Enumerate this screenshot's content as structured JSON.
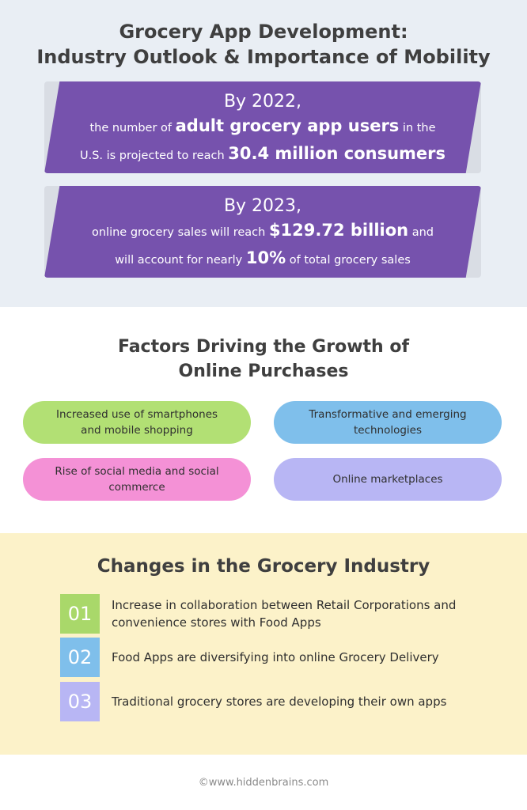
{
  "header": {
    "title_line1": "Grocery App Development:",
    "title_line2": "Industry Outlook & Importance of Mobility"
  },
  "stats": [
    {
      "year": "By 2022,",
      "line1_pre": "the number of ",
      "line1_bold": "adult grocery app users",
      "line1_post": " in the",
      "line2_pre": "U.S. is projected to reach ",
      "line2_bold": "30.4 million consumers",
      "line2_post": ""
    },
    {
      "year": "By 2023,",
      "line1_pre": "online grocery sales will reach ",
      "line1_bold": "$129.72 billion",
      "line1_post": " and",
      "line2_pre": "will account for nearly ",
      "line2_bold": "10%",
      "line2_post": " of total grocery sales"
    }
  ],
  "factors": {
    "title_line1": "Factors Driving the Growth of",
    "title_line2": "Online Purchases",
    "items": [
      {
        "line1": "Increased use of smartphones",
        "line2": "and mobile shopping",
        "color": "#b2e074"
      },
      {
        "line1": "Transformative and emerging",
        "line2": "technologies",
        "color": "#7fbfeb"
      },
      {
        "line1": "Rise of social media and social",
        "line2": "commerce",
        "color": "#f491d6"
      },
      {
        "line1": "Online marketplaces",
        "line2": "",
        "color": "#b8b6f4"
      }
    ]
  },
  "changes": {
    "title": "Changes in the Grocery Industry",
    "items": [
      {
        "num": "01",
        "line1": "Increase in collaboration between Retail Corporations and",
        "line2": "convenience stores with Food Apps",
        "color": "#a9d86a"
      },
      {
        "num": "02",
        "line1": "Food Apps are diversifying into online Grocery Delivery",
        "line2": "",
        "color": "#7fbfeb"
      },
      {
        "num": "03",
        "line1": "Traditional grocery stores are developing their own apps",
        "line2": "",
        "color": "#b8b6f4"
      }
    ]
  },
  "footer": {
    "credit": "©www.hiddenbrains.com"
  },
  "colors": {
    "banner": "#7652ad",
    "top_background": "#e9eef4",
    "changes_background": "#fcf2c9"
  }
}
